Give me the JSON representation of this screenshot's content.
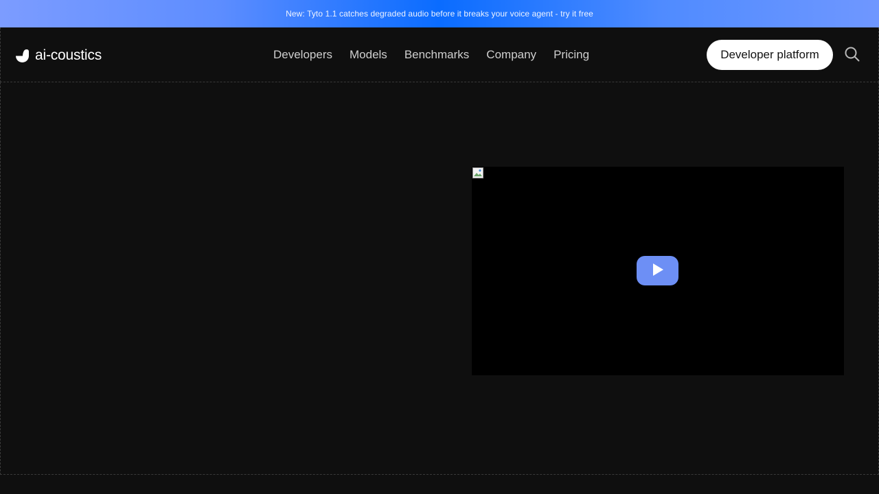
{
  "announcement": {
    "text": "New: Tyto 1.1 catches degraded audio before it breaks your voice agent - try it free"
  },
  "header": {
    "logo": {
      "icon": "bird-logo-icon",
      "text": "ai-coustics"
    },
    "nav": [
      {
        "label": "Developers"
      },
      {
        "label": "Models"
      },
      {
        "label": "Benchmarks"
      },
      {
        "label": "Company"
      },
      {
        "label": "Pricing"
      }
    ],
    "cta_label": "Developer platform",
    "search_icon": "search-icon"
  },
  "hero": {
    "video": {
      "thumbnail_icon": "broken-image-icon",
      "play_icon": "play-icon"
    }
  },
  "colors": {
    "background": "#0f0f0f",
    "announcement_accent": "#0a6cff",
    "play_button": "#6d8ff5",
    "cta_background": "#ffffff"
  }
}
